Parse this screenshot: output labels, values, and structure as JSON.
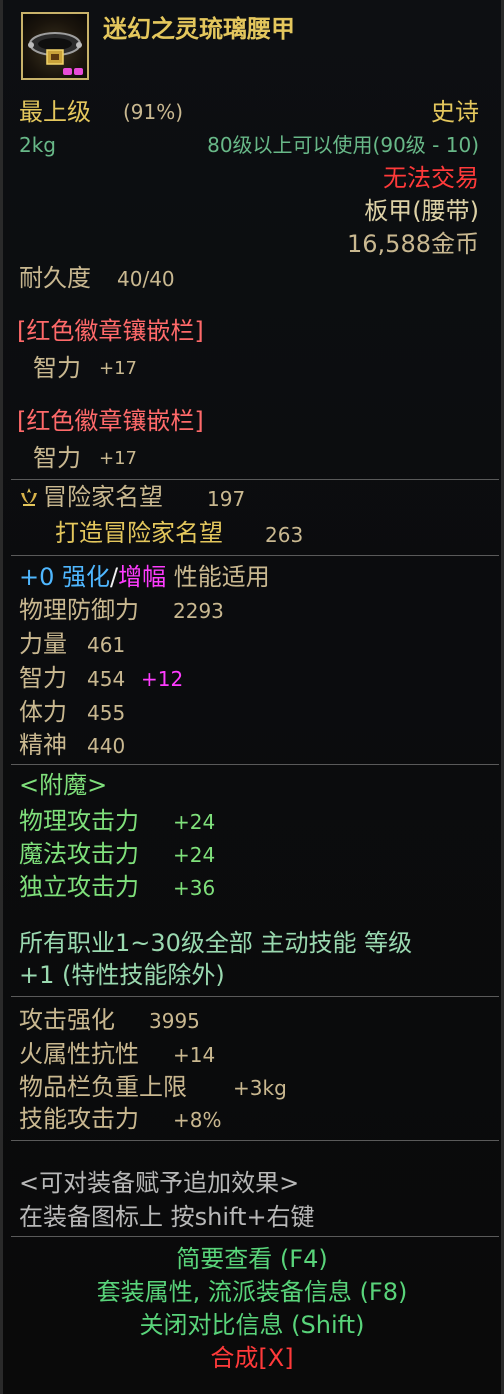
{
  "item": {
    "name": "迷幻之灵琉璃腰甲",
    "grade_label": "最上级",
    "grade_percent": "(91%)",
    "rarity": "史诗",
    "weight": "2kg",
    "level_req": "80级以上可以使用(90级 - 10)",
    "trade": "无法交易",
    "type": "板甲(腰带)",
    "price": "16,588金币",
    "durability_label": "耐久度",
    "durability": "40/40"
  },
  "sockets": [
    {
      "title": "[红色徽章镶嵌栏]",
      "stat": "智力",
      "value": "+17"
    },
    {
      "title": "[红色徽章镶嵌栏]",
      "stat": "智力",
      "value": "+17"
    }
  ],
  "reputation": {
    "label": "冒险家名望",
    "value": "197",
    "forge_label": "打造冒险家名望",
    "forge_value": "263"
  },
  "enhance": {
    "level": "+0",
    "word_enhance": "强化",
    "slash": "/",
    "word_amplify": "增幅",
    "suffix": "性能适用"
  },
  "base_stats": [
    {
      "name": "物理防御力",
      "value": "2293",
      "bonus": ""
    },
    {
      "name": "力量",
      "value": "461",
      "bonus": ""
    },
    {
      "name": "智力",
      "value": "454",
      "bonus": "+12"
    },
    {
      "name": "体力",
      "value": "455",
      "bonus": ""
    },
    {
      "name": "精神",
      "value": "440",
      "bonus": ""
    }
  ],
  "enchant": {
    "title": "<附魔>",
    "lines": [
      {
        "name": "物理攻击力",
        "value": "+24"
      },
      {
        "name": "魔法攻击力",
        "value": "+24"
      },
      {
        "name": "独立攻击力",
        "value": "+36"
      }
    ]
  },
  "skill": {
    "line1": "所有职业1~30级全部 主动技能 等级",
    "line2": "+1 (特性技能除外)"
  },
  "options": [
    {
      "name": "攻击强化",
      "value": "3995"
    },
    {
      "name": "火属性抗性",
      "value": "+14"
    },
    {
      "name": "物品栏负重上限",
      "value": "+3kg"
    },
    {
      "name": "技能攻击力",
      "value": "+8%"
    }
  ],
  "bonus_effect": {
    "title": "<可对装备赋予追加效果>",
    "hint": "在装备图标上 按shift+右键"
  },
  "menu": {
    "brief": "简要查看 (F4)",
    "set_info": "套装属性, 流派装备信息 (F8)",
    "close_compare": "关闭对比信息 (Shift)",
    "synthesize": "合成[X]"
  },
  "colors": {
    "name": "#e4c75d",
    "rarity": "#e4c75d",
    "untradeable": "#ff3a3a",
    "enhance_blue": "#4fb7ff",
    "amplify_magenta": "#ff3cff",
    "enchant_green": "#7fe07b"
  }
}
